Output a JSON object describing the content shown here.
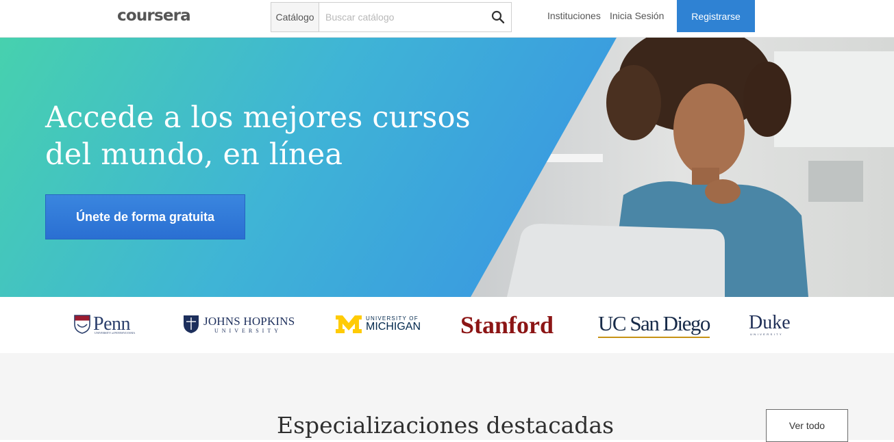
{
  "header": {
    "logo": "coursera",
    "search": {
      "catalog_label": "Catálogo",
      "placeholder": "Buscar catálogo"
    },
    "nav": {
      "institutions": "Instituciones",
      "login": "Inicia Sesión",
      "register": "Registrarse"
    }
  },
  "hero": {
    "title": "Accede a los mejores cursos del mundo, en línea",
    "cta": "Únete de forma gratuita"
  },
  "partners": {
    "penn": {
      "name": "Penn",
      "sub": "UNIVERSITY of PENNSYLVANIA"
    },
    "jhu": {
      "name": "JOHNS HOPKINS",
      "sub": "UNIVERSITY"
    },
    "umich": {
      "pre": "UNIVERSITY OF",
      "name": "MICHIGAN"
    },
    "stanford": {
      "name": "Stanford"
    },
    "ucsd": {
      "name": "UC San Diego"
    },
    "duke": {
      "name": "Duke",
      "sub": "UNIVERSITY"
    }
  },
  "featured": {
    "title": "Especializaciones destacadas",
    "see_all": "Ver todo"
  },
  "colors": {
    "primary": "#2f82d3",
    "hero_gradient_start": "#46cfb0",
    "hero_gradient_end": "#3a9fe0",
    "section_bg": "#f5f5f5"
  }
}
